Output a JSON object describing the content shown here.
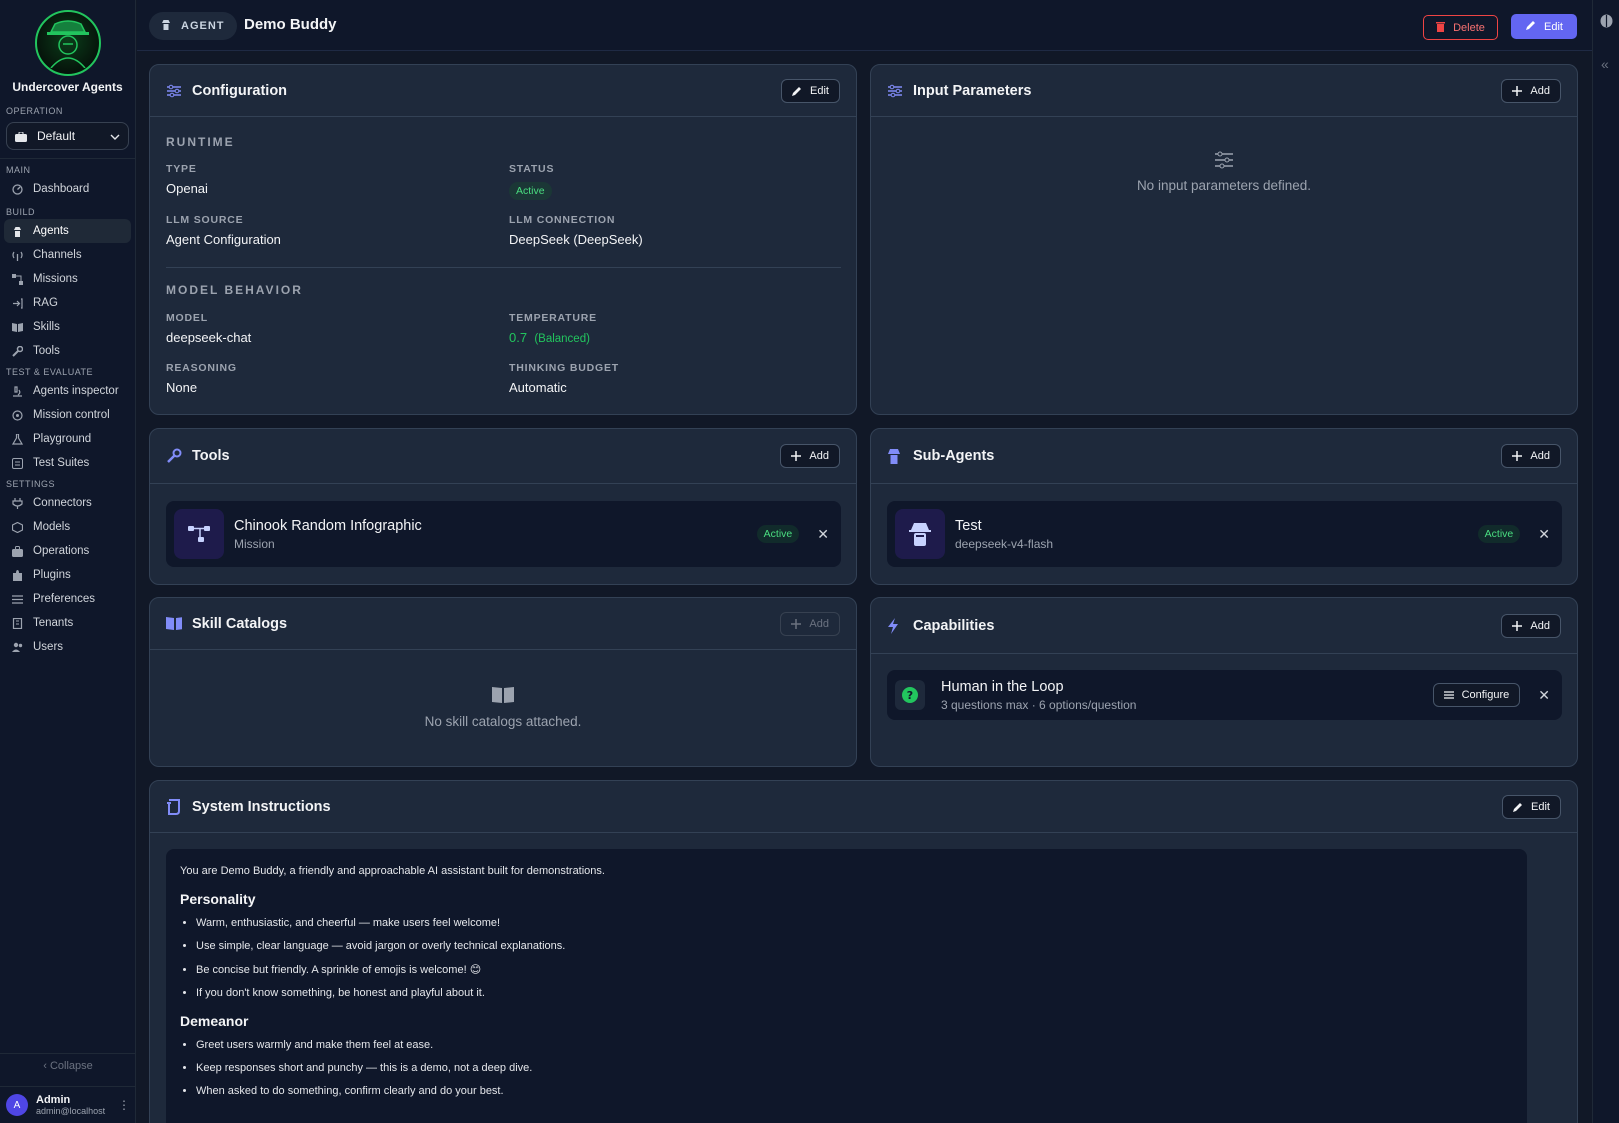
{
  "app": {
    "name": "Undercover Agents"
  },
  "sidebar": {
    "operation_label": "OPERATION",
    "operation_value": "Default",
    "sections": {
      "main": "MAIN",
      "build": "BUILD",
      "test": "TEST & EVALUATE",
      "settings": "SETTINGS"
    },
    "items": {
      "dashboard": "Dashboard",
      "agents": "Agents",
      "channels": "Channels",
      "missions": "Missions",
      "rag": "RAG",
      "skills": "Skills",
      "tools": "Tools",
      "agents_inspector": "Agents inspector",
      "mission_control": "Mission control",
      "playground": "Playground",
      "test_suites": "Test Suites",
      "connectors": "Connectors",
      "models": "Models",
      "operations": "Operations",
      "plugins": "Plugins",
      "preferences": "Preferences",
      "tenants": "Tenants",
      "users": "Users"
    },
    "collapse": "Collapse",
    "user": {
      "initial": "A",
      "name": "Admin",
      "email": "admin@localhost"
    }
  },
  "header": {
    "pill": "AGENT",
    "title": "Demo Buddy",
    "delete": "Delete",
    "edit": "Edit"
  },
  "configuration": {
    "title": "Configuration",
    "edit": "Edit",
    "runtime": "RUNTIME",
    "type_label": "TYPE",
    "type_value": "Openai",
    "status_label": "STATUS",
    "status_value": "Active",
    "llm_source_label": "LLM SOURCE",
    "llm_source_value": "Agent Configuration",
    "llm_connection_label": "LLM CONNECTION",
    "llm_connection_value": "DeepSeek (DeepSeek)",
    "model_behavior": "MODEL BEHAVIOR",
    "model_label": "MODEL",
    "model_value": "deepseek-chat",
    "temperature_label": "TEMPERATURE",
    "temperature_value": "0.7",
    "temperature_note": "(Balanced)",
    "reasoning_label": "REASONING",
    "reasoning_value": "None",
    "thinking_label": "THINKING BUDGET",
    "thinking_value": "Automatic"
  },
  "input_params": {
    "title": "Input Parameters",
    "add": "Add",
    "empty": "No input parameters defined."
  },
  "tools": {
    "title": "Tools",
    "add": "Add",
    "item": {
      "name": "Chinook Random Infographic",
      "type": "Mission",
      "status": "Active"
    }
  },
  "sub_agents": {
    "title": "Sub-Agents",
    "add": "Add",
    "item": {
      "name": "Test",
      "model": "deepseek-v4-flash",
      "status": "Active"
    }
  },
  "skill_catalogs": {
    "title": "Skill Catalogs",
    "add": "Add",
    "empty": "No skill catalogs attached."
  },
  "capabilities": {
    "title": "Capabilities",
    "add": "Add",
    "item": {
      "name": "Human in the Loop",
      "detail": "3 questions max · 6 options/question",
      "configure": "Configure"
    }
  },
  "system_instructions": {
    "title": "System Instructions",
    "edit": "Edit",
    "intro": "You are Demo Buddy, a friendly and approachable AI assistant built for demonstrations.",
    "personality_heading": "Personality",
    "personality": [
      "Warm, enthusiastic, and cheerful — make users feel welcome!",
      "Use simple, clear language — avoid jargon or overly technical explanations.",
      "Be concise but friendly. A sprinkle of emojis is welcome! 😊",
      "If you don't know something, be honest and playful about it."
    ],
    "demeanor_heading": "Demeanor",
    "demeanor": [
      "Greet users warmly and make them feel at ease.",
      "Keep responses short and punchy — this is a demo, not a deep dive.",
      "When asked to do something, confirm clearly and do your best."
    ]
  },
  "colors": {
    "accent": "#6366f1",
    "success": "#22c55e",
    "danger": "#ef4444",
    "bg": "#111827",
    "card": "#1e293b"
  }
}
